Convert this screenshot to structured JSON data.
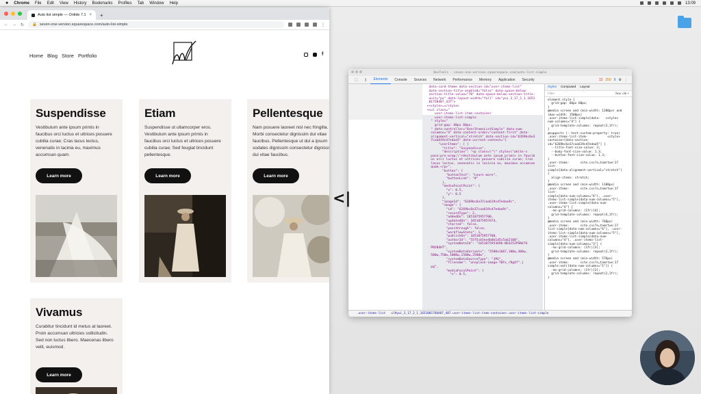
{
  "menubar": {
    "app": "Chrome",
    "items": [
      "File",
      "Edit",
      "View",
      "History",
      "Bookmarks",
      "Profiles",
      "Tab",
      "Window",
      "Help"
    ],
    "clock": "13:09"
  },
  "browser": {
    "tab_title": "Auto list simple — Onlide 7.1",
    "tab_close": "×",
    "new_tab": "+",
    "url": "seven-one-version.squarespace.com/auto-list-simple"
  },
  "site": {
    "nav": [
      "Home",
      "Blog",
      "Store",
      "Portfolio"
    ],
    "cards": [
      {
        "title": "Suspendisse",
        "body": "Vestibulum ante ipsum primis in faucibus orci luctus et ultrices posuere cubilia curae; Cras lacus lectus, venenatis in lacinia eu, maximus accumsan quam.",
        "button": "Learn more"
      },
      {
        "title": "Etiam",
        "body": "Suspendisse ut ullamcorper eros. Vestibulum ante ipsum primis in faucibus orci luctus et ultrices posuere cubilia curae; Sed feugiat tincidunt pellentesque.",
        "button": "Learn more"
      },
      {
        "title": "Pellentesque",
        "body": "Nam posuere laoreet nisl nec fringilla. Morbi consectetur dignissim dui vitae faucibus. Pellentesque ut dui a ipsum sodales dignissim consectetur dignissim dui vitae faucibus.",
        "button": "Learn more"
      },
      {
        "title": "Vivamus",
        "body": "Curabitur tincidunt id metus at laoreet. Proin accumsan ultricies sollicitudin. Sed non luctus libero. Maecenas libero velit, euismod.",
        "button": "Learn more"
      }
    ]
  },
  "devtools": {
    "title": "DevTools - seven-one-version.squarespace.com/auto-list-simple",
    "tabs": [
      "Elements",
      "Console",
      "Sources",
      "Network",
      "Performance",
      "Memory",
      "Application",
      "Security"
    ],
    "badges": {
      "errors": "12",
      "warnings": "250",
      "info": "8"
    },
    "styles_tabs": [
      "Styles",
      "Computed",
      "Layout"
    ],
    "filter_placeholder": "Filter",
    "filter_right": ":hov .cls +",
    "code": "  data-card-theme data-section-id=\"user-items-list\"\n  data-section-title-enabled=\"false\" data-space-below-\n  section-title-value=\"70\" data-space-below-section-title-\n  unit=\"px\" data-layout-width=\"full\" id=\"yui_3_17_2_1_1651\n  0175840?_437\">\n ▸<style>…</style>\n ▾<ul class=\"\n     user-items-list-item-container\n     user-items-list-simple\n   \" style=\"\n     grid-gap: 60px 60px;\n   \" data-controller=\"UserItemsListSimple\" data-num-\n   columns=\"4\" data-content-order=\"content-first\" data-\n   alignment-vertical=\"stretch\" data-section-id=\"6269bc6e3\n   7caa619cd7edaa5\" data-current-context=\"{\n       \"userItems\": [ {\n         \"title\": \"Suspendisse\",\n         \"description\": \"<p class=\\\"\\\" style=\\\"white-s\n   pace:pre-wrap;\\\">Vestibulum ante ipsum primis in faucib\n   us orci luctus et ultrices posuere cubilia curae; Cras\n   lacus lectus, venenatis in lacinia eu, maximus accumsan\n   quam.</p>\",\n         \"button\": {\n           \"buttonText\": \"Learn more\",\n           \"buttonLink\": \"#\"\n         },\n         \"mediaFocalPoint\": {\n           \"x\": 0.5,\n           \"y\": 0.5\n         },\n         \"imageId\": \"6269bc6e37caa619cd7edaa9c\",\n         \"image\": {\n           \"id\": \"6269bc6e37caa619cd7edaa9c\",\n           \"recordType\": 2,\n           \"addedOn\": 1651075957700,\n           \"updatedOn\": 1651075957674,\n           \"starred\": false,\n           \"passthrough\": false,\n           \"workflowState\": 1,\n           \"publishOn\": 1651075957700,\n           \"authorId\": \"55f5cb5ee4b0b1d5c5ab2100\",\n           \"systemDataId\": \"1651075953696-NEOJ52PSN47O\n   PNJB4HT\",\n           \"systemDataVariants\": \"2500x1667,100w,300w,\n   500w,750w,1000w,1500w,2500w\",\n           \"systemDataSourceType\": \"JPG\",\n           \"filename\": \"unsplash-image-T0Fx_rRg4f\".j\n   pg\",\n           \"mediaFocalPoint\": {\n             \"x\": 0.5,",
    "styles": "element.style {\n  grid-gap: 60px 60px;\n}\n@media screen and (min-width: 1200px) and\n(max-width: 1500px)\n.user-items-list-simple[data-   <style>\nnum-columns=\"4\"] {\n  grid-template-columns: repeat(3,1fr);\n}\n@supports (--test-custom-property: true)\n.user-items-list-item-           <style>\ncontainer[data-section-\nid=\"6269bc6e37caa619cd7edaa5\"] {\n  --title-font-size-value: 3;\n  --body-font-size-value: 1.3;\n  --button-font-size-value: 1.3;\n}\n.user-items-      site.css?n…tamrtue:17\nlist-\nsimple[data-alignment-vertical=\"stretch\"]\n{\n  align-items: stretch;\n}\n@media screen and (min-width: 1100px)\n.user-items-      site.css?n…tamrtue:17\nlist-\nsimple[data-num-columns=\"6\"], .user-\nitems-list-simple[data-num-columns=\"5\"],\n.user-items-list-simple[data-num-\ncolumns=\"4\"] {\n  -ms-grid-columns: (1fr)[4];\n  grid-template-columns: repeat(4,1fr);\n}\n@media screen and (min-width: 768px)\n.user-items-      site.css?n…tamrtue:17\nlist-simple[data-num-columns=\"6\"], .user-\nitems-list-simple[data-num-columns=\"5\"],\n.user-items-list-simple[data-num-\ncolumns=\"4\"], .user-items-list-\nsimple[data-num-columns=\"3\"] {\n  -ms-grid-columns: (1fr)[3];\n  grid-template-columns: repeat(3,1fr);\n}\n@media screen and (min-width: 576px)\n.user-items-      site.css?n…tamrtue:17\nsimple:not([data-num-columns=\"1\"]) {\n  -ms-grid-columns: (1fr)[2];\n  grid-template-columns: repeat(2,1fr);\n}",
    "crumbs": [
      ".user-items-list",
      "ul#yui_3_17_2_1_1651081760487_487.user-items-list-item-container.user-items-list-simple"
    ]
  },
  "icons": [
    "apple-icon",
    "search-icon",
    "wifi-icon",
    "battery-icon",
    "folder-icon",
    "drag-handle-icon"
  ],
  "colors": {
    "card_bg": "#f3f0ee",
    "button_bg": "#111111",
    "devtools_accent": "#1a73e8"
  }
}
